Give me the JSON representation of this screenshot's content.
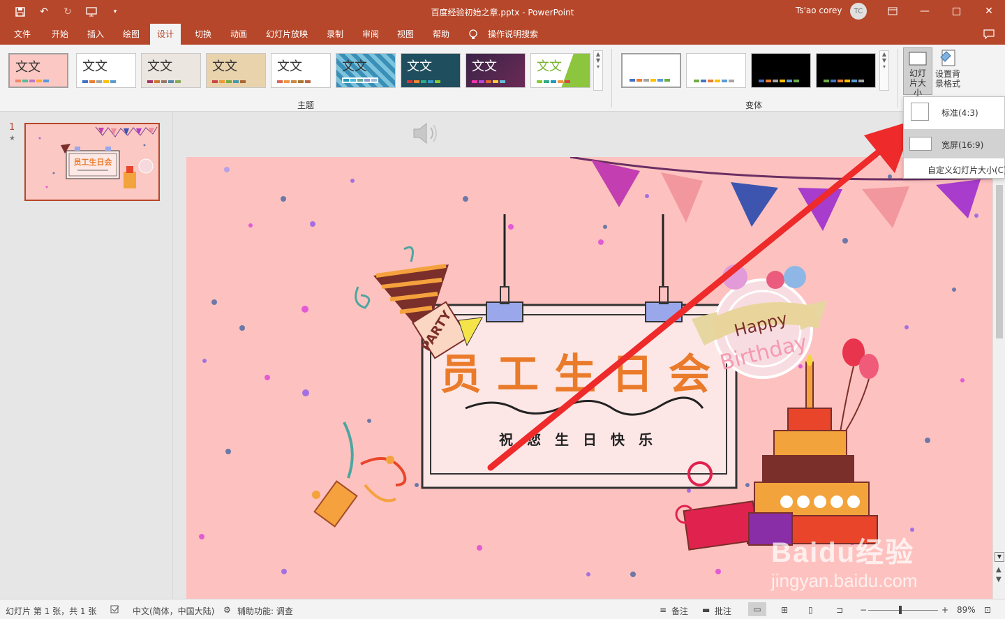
{
  "titlebar": {
    "document_title": "百度经验初始之章.pptx  -  PowerPoint",
    "user_name": "Ts'ao corey",
    "avatar_initials": "TC",
    "bg_color": "#b7472a"
  },
  "tabs": [
    "文件",
    "开始",
    "插入",
    "绘图",
    "设计",
    "切换",
    "动画",
    "幻灯片放映",
    "录制",
    "审阅",
    "视图",
    "帮助",
    "操作说明搜索"
  ],
  "active_tab": "设计",
  "ribbon": {
    "themes": [
      {
        "label": "文文",
        "bg": "#fbc8c3"
      },
      {
        "label": "文文",
        "bg": "#ffffff"
      },
      {
        "label": "文文",
        "bg": "#f0ece8"
      },
      {
        "label": "文文",
        "bg": "#e8d5b5"
      },
      {
        "label": "文文",
        "bg": "#ffffff"
      },
      {
        "label": "文文",
        "bg": "#4a9ec4"
      },
      {
        "label": "文文",
        "bg": "#1e4d5c"
      },
      {
        "label": "文文",
        "bg": "#4a2b4d"
      },
      {
        "label": "文文",
        "bg": "#ffffff"
      }
    ],
    "themes_group_label": "主题",
    "variants_group_label": "变体",
    "slide_size_button": "幻灯片大小",
    "format_bg_button": "设置背景格式"
  },
  "slide_size_menu": {
    "items": [
      {
        "label": "标准(4:3)"
      },
      {
        "label": "宽屏(16:9)"
      }
    ],
    "custom_label": "自定义幻灯片大小(C)"
  },
  "slide_panel": {
    "slide_number": "1",
    "star": "★"
  },
  "slide": {
    "main_title": "员工生日会",
    "subtitle": "祝您生日快乐",
    "party_text": "PARTY",
    "happy_text": "Happy",
    "birthday_text": "Birthday",
    "thumb_title": "员工生日会"
  },
  "watermark": {
    "brand": "Baidu经验",
    "url": "jingyan.baidu.com"
  },
  "status": {
    "slide_info": "幻灯片 第 1 张，共 1 张",
    "language": "中文(简体，中国大陆)",
    "accessibility": "辅助功能: 调查",
    "notes": "备注",
    "comments": "批注",
    "zoom": "89%"
  }
}
